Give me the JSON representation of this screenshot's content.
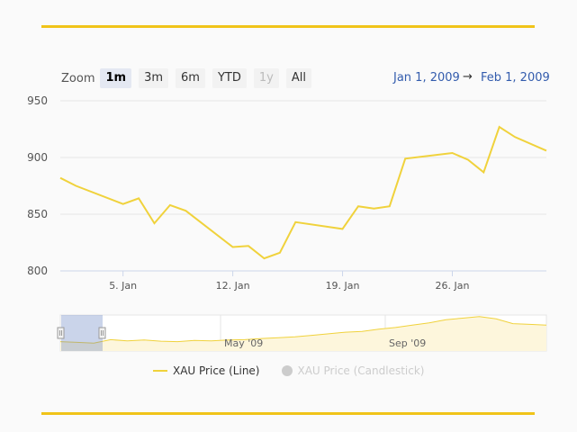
{
  "zoom": {
    "label": "Zoom",
    "buttons": [
      "1m",
      "3m",
      "6m",
      "YTD",
      "1y",
      "All"
    ],
    "active": "1m",
    "disabled": "1y"
  },
  "range": {
    "from": "Jan 1, 2009",
    "arrow": "→",
    "to": "Feb 1, 2009"
  },
  "colors": {
    "line": "#f0d23c",
    "accent": "#f0c419",
    "link": "#335cad"
  },
  "chart_data": {
    "type": "line",
    "ylim": [
      800,
      950
    ],
    "y_ticks": [
      "800",
      "850",
      "900",
      "950"
    ],
    "x_ticks": [
      "5. Jan",
      "12. Jan",
      "19. Jan",
      "26. Jan"
    ],
    "series": [
      {
        "name": "XAU Price (Line)",
        "x": [
          "2009-01-01",
          "2009-01-02",
          "2009-01-05",
          "2009-01-06",
          "2009-01-07",
          "2009-01-08",
          "2009-01-09",
          "2009-01-12",
          "2009-01-13",
          "2009-01-14",
          "2009-01-15",
          "2009-01-16",
          "2009-01-19",
          "2009-01-20",
          "2009-01-21",
          "2009-01-22",
          "2009-01-23",
          "2009-01-26",
          "2009-01-27",
          "2009-01-28",
          "2009-01-29",
          "2009-01-30",
          "2009-02-01"
        ],
        "values": [
          882,
          875,
          859,
          864,
          842,
          858,
          853,
          821,
          822,
          811,
          816,
          843,
          837,
          857,
          855,
          857,
          899,
          904,
          898,
          887,
          927,
          918,
          906
        ]
      }
    ],
    "navigator": {
      "labels": [
        "May '09",
        "Sep '09"
      ],
      "values": [
        880,
        870,
        860,
        905,
        890,
        900,
        885,
        880,
        895,
        890,
        900,
        905,
        920,
        930,
        940,
        960,
        980,
        1000,
        1010,
        1040,
        1060,
        1090,
        1120,
        1160,
        1180,
        1200,
        1170,
        1110,
        1100,
        1090
      ]
    },
    "legend": [
      {
        "label": "XAU Price (Line)",
        "visible": true
      },
      {
        "label": "XAU Price (Candlestick)",
        "visible": false
      }
    ]
  }
}
